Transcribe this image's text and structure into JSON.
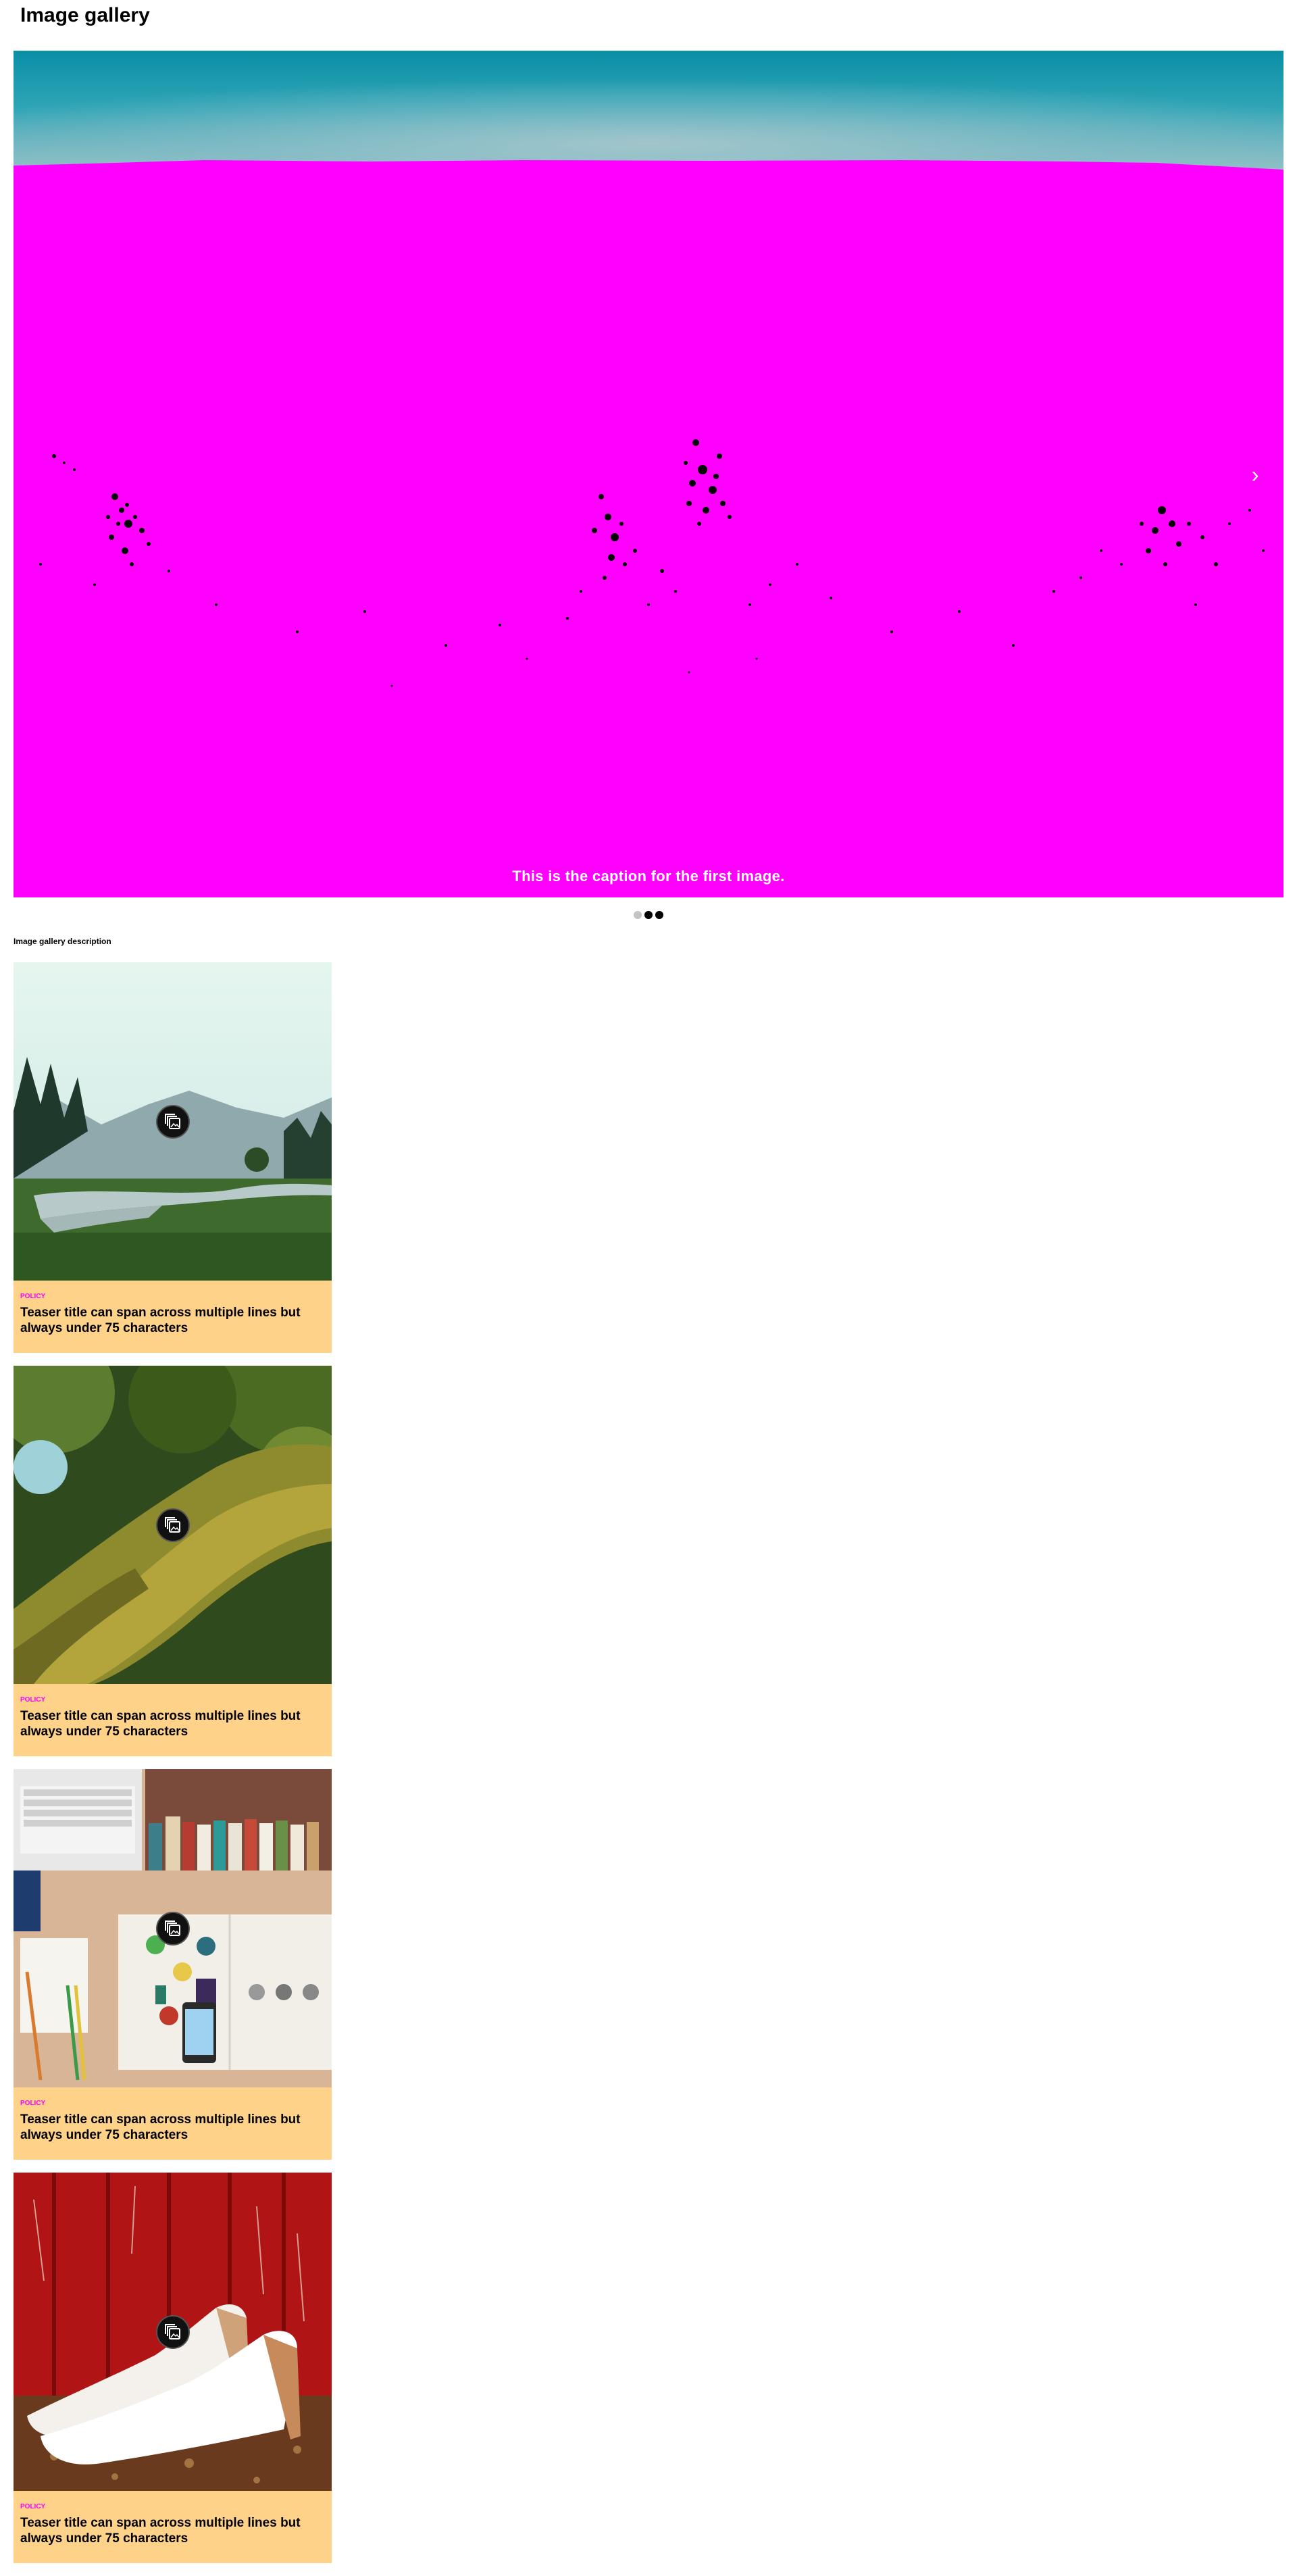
{
  "page": {
    "title": "Image gallery",
    "description": "Image gallery description"
  },
  "carousel": {
    "caption": "This is the caption for the first image.",
    "next_icon": "chevron-right-icon",
    "slide_count": 3,
    "active_slide": 1
  },
  "teasers": [
    {
      "category": "POLICY",
      "title": "Teaser title can span across multiple lines but always under 75 characters",
      "image": "misty-river-valley",
      "icon": "gallery-icon"
    },
    {
      "category": "POLICY",
      "title": "Teaser title can span across multiple lines but always under 75 characters",
      "image": "mossy-tree-trunk",
      "icon": "gallery-icon"
    },
    {
      "category": "POLICY",
      "title": "Teaser title can span across multiple lines but always under 75 characters",
      "image": "desk-with-laptop-and-magazine",
      "icon": "gallery-icon"
    },
    {
      "category": "POLICY",
      "title": "Teaser title can span across multiple lines but always under 75 characters",
      "image": "white-shoes-on-red-floor",
      "icon": "gallery-icon"
    }
  ],
  "colors": {
    "accent": "#ff00ff",
    "card_background": "#ffd28a",
    "badge": "#111111"
  }
}
